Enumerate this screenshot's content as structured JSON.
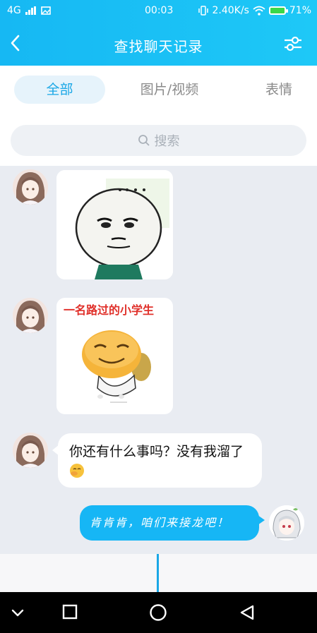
{
  "status": {
    "network": "4G",
    "time": "00:03",
    "speed": "2.40K/s",
    "battery": "71%"
  },
  "header": {
    "title": "查找聊天记录"
  },
  "tabs": [
    {
      "label": "全部",
      "active": true
    },
    {
      "label": "图片/视频",
      "active": false
    },
    {
      "label": "表情",
      "active": false
    }
  ],
  "search": {
    "placeholder": "搜索"
  },
  "messages": [
    {
      "type": "sticker",
      "side": "left",
      "sticker": "panda-face-sticker"
    },
    {
      "type": "sticker",
      "side": "left",
      "sticker": "smiling-emoji-student-sticker",
      "caption": "一名路过的小学生"
    },
    {
      "type": "text",
      "side": "left",
      "text": "你还有什么事吗？没有我溜了"
    },
    {
      "type": "text",
      "side": "right",
      "text": "肯肯肯，咱们来接龙吧！"
    }
  ],
  "colors": {
    "accent": "#1aa7e6",
    "header": "#16b8f3",
    "chat_bg": "#e9ecf2",
    "outgoing_bubble": "#16b6f5"
  },
  "icons": {
    "back": "back-arrow-icon",
    "filter": "filter-sliders-icon",
    "search": "search-icon",
    "nav_back": "triangle-back-icon",
    "nav_home": "circle-home-icon",
    "nav_recent": "square-recent-icon",
    "nav_hide": "chevron-down-icon"
  }
}
